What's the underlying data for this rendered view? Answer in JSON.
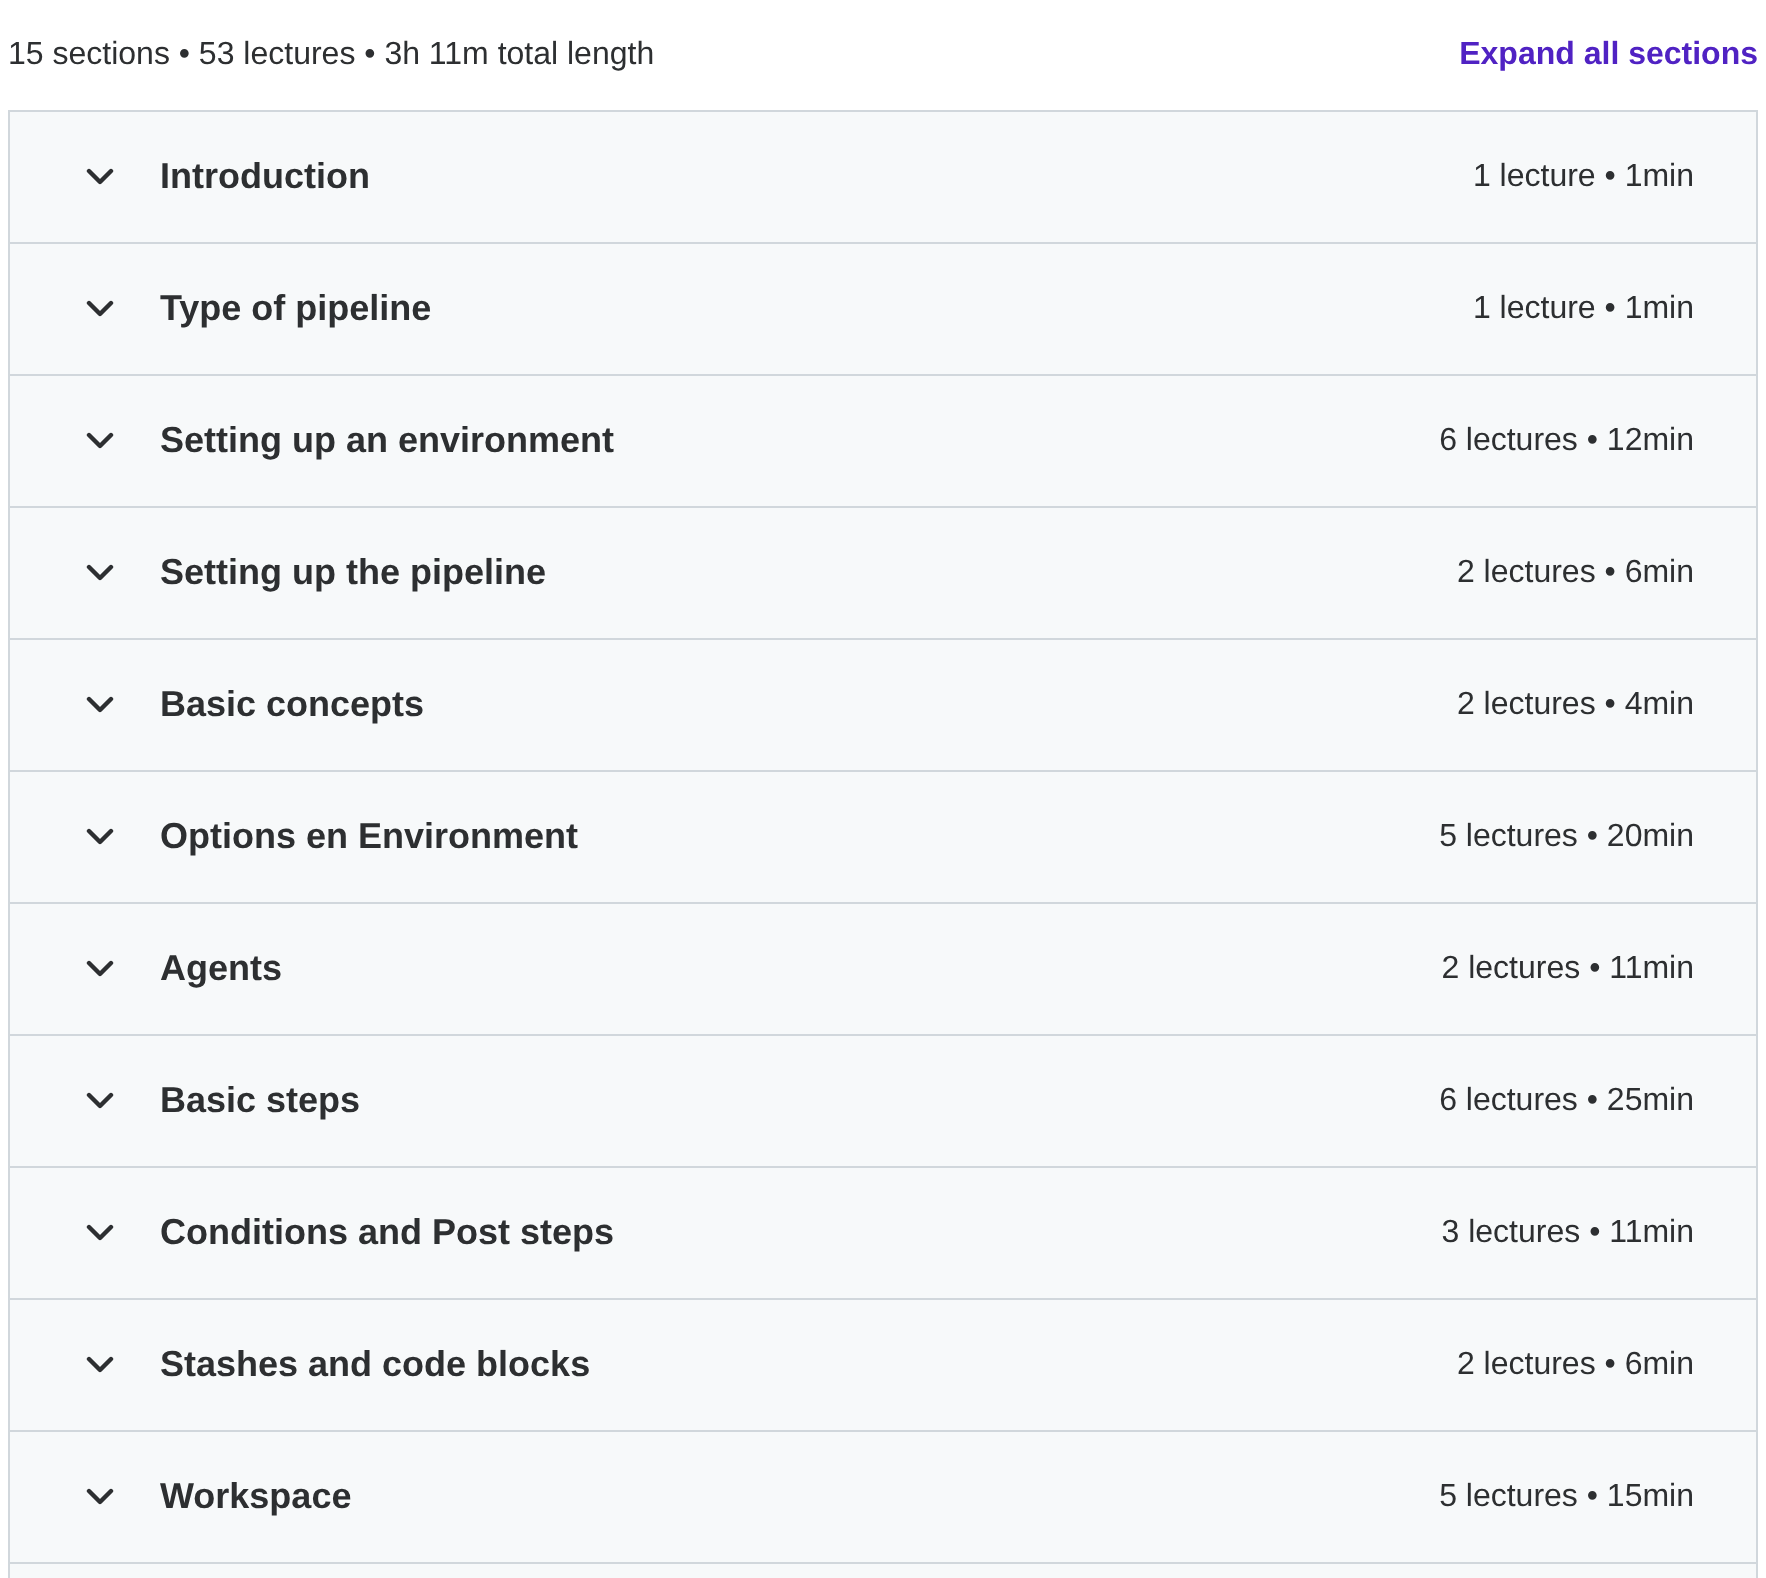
{
  "summary": "15 sections • 53 lectures • 3h 11m total length",
  "expand_all": "Expand all sections",
  "sections": [
    {
      "title": "Introduction",
      "meta": "1 lecture • 1min",
      "expanded": false
    },
    {
      "title": "Type of pipeline",
      "meta": "1 lecture • 1min",
      "expanded": false
    },
    {
      "title": "Setting up an environment",
      "meta": "6 lectures • 12min",
      "expanded": false
    },
    {
      "title": "Setting up the pipeline",
      "meta": "2 lectures • 6min",
      "expanded": false
    },
    {
      "title": "Basic concepts",
      "meta": "2 lectures • 4min",
      "expanded": false
    },
    {
      "title": "Options en Environment",
      "meta": "5 lectures • 20min",
      "expanded": false
    },
    {
      "title": "Agents",
      "meta": "2 lectures • 11min",
      "expanded": false
    },
    {
      "title": "Basic steps",
      "meta": "6 lectures • 25min",
      "expanded": false
    },
    {
      "title": "Conditions and Post steps",
      "meta": "3 lectures • 11min",
      "expanded": false
    },
    {
      "title": "Stashes and code blocks",
      "meta": "2 lectures • 6min",
      "expanded": false
    },
    {
      "title": "Workspace",
      "meta": "5 lectures • 15min",
      "expanded": false
    }
  ]
}
